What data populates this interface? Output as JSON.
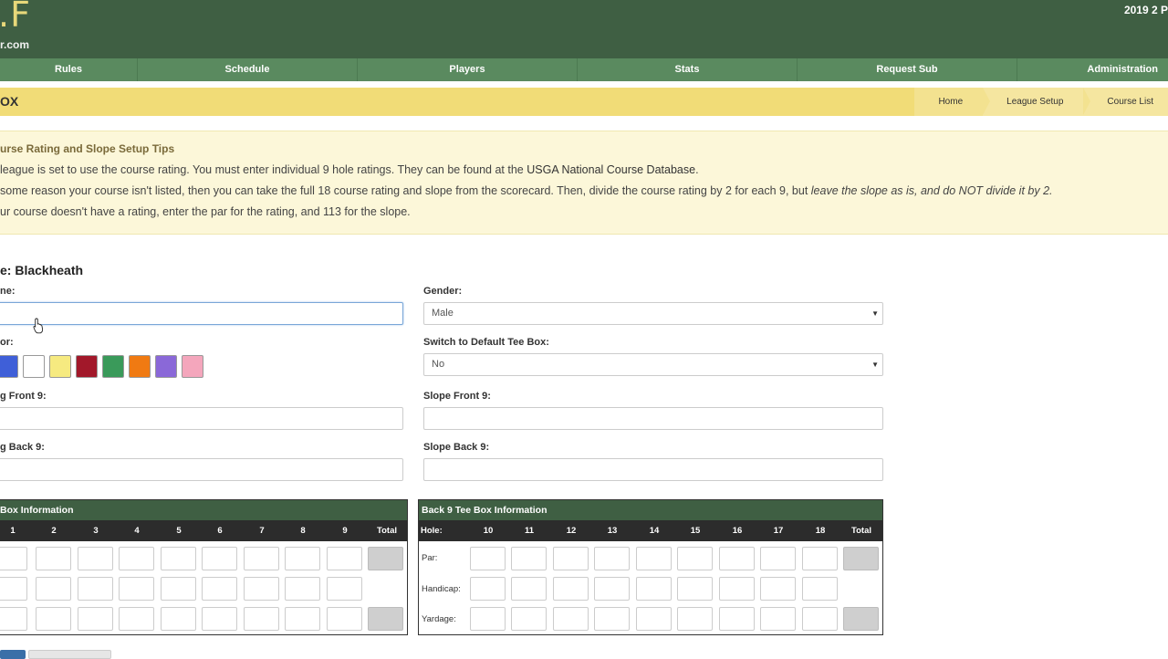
{
  "header": {
    "logo": ".F",
    "logo_sub": "r.com",
    "season": "2019 2 P"
  },
  "nav": [
    {
      "label": "Rules"
    },
    {
      "label": "Schedule"
    },
    {
      "label": "Players"
    },
    {
      "label": "Stats"
    },
    {
      "label": "Request Sub"
    },
    {
      "label": "Administration"
    }
  ],
  "title_bar": {
    "title": "OX",
    "breadcrumbs": [
      "Home",
      "League Setup",
      "Course List"
    ]
  },
  "tips": {
    "title": "urse Rating and Slope Setup Tips",
    "line1_pre": "league is set to use the course rating. You must enter individual 9 hole ratings. They can be found at the ",
    "line1_link": "USGA National Course Database",
    "line1_post": ".",
    "line2_pre": "some reason your course isn't listed, then you can take the full 18 course rating and slope from the scorecard. Then, divide the course rating by 2 for each 9, but ",
    "line2_em": "leave the slope as is, and do NOT divide it by 2.",
    "line3": "ur course doesn't have a rating, enter the par for the rating, and 113 for the slope."
  },
  "form": {
    "section_title": "e: Blackheath",
    "name_label": "ne:",
    "name_value": "",
    "gender_label": "Gender:",
    "gender_value": "Male",
    "color_label": "or:",
    "colors": [
      "#3f5fd8",
      "#ffffff",
      "#f6ea80",
      "#a2182a",
      "#3a9a5a",
      "#f07a12",
      "#8a68d8",
      "#f4a6bc"
    ],
    "default_tee_label": "Switch to Default Tee Box:",
    "default_tee_value": "No",
    "rating_front_label": "g Front 9:",
    "slope_front_label": "Slope Front 9:",
    "rating_back_label": "g Back 9:",
    "slope_back_label": "Slope Back 9:"
  },
  "front_panel": {
    "title": "Box Information",
    "holes": [
      "1",
      "2",
      "3",
      "4",
      "5",
      "6",
      "7",
      "8",
      "9",
      "Total"
    ]
  },
  "back_panel": {
    "title": "Back 9 Tee Box Information",
    "hole_label": "Hole:",
    "holes": [
      "10",
      "11",
      "12",
      "13",
      "14",
      "15",
      "16",
      "17",
      "18",
      "Total"
    ],
    "rows": [
      "Par:",
      "Handicap:",
      "Yardage:"
    ]
  },
  "colors": {
    "header_bg": "#3f5f43",
    "nav_bg": "#5a8a5f",
    "title_bar_bg": "#f1dc77",
    "tips_bg": "#fcf7d9"
  }
}
